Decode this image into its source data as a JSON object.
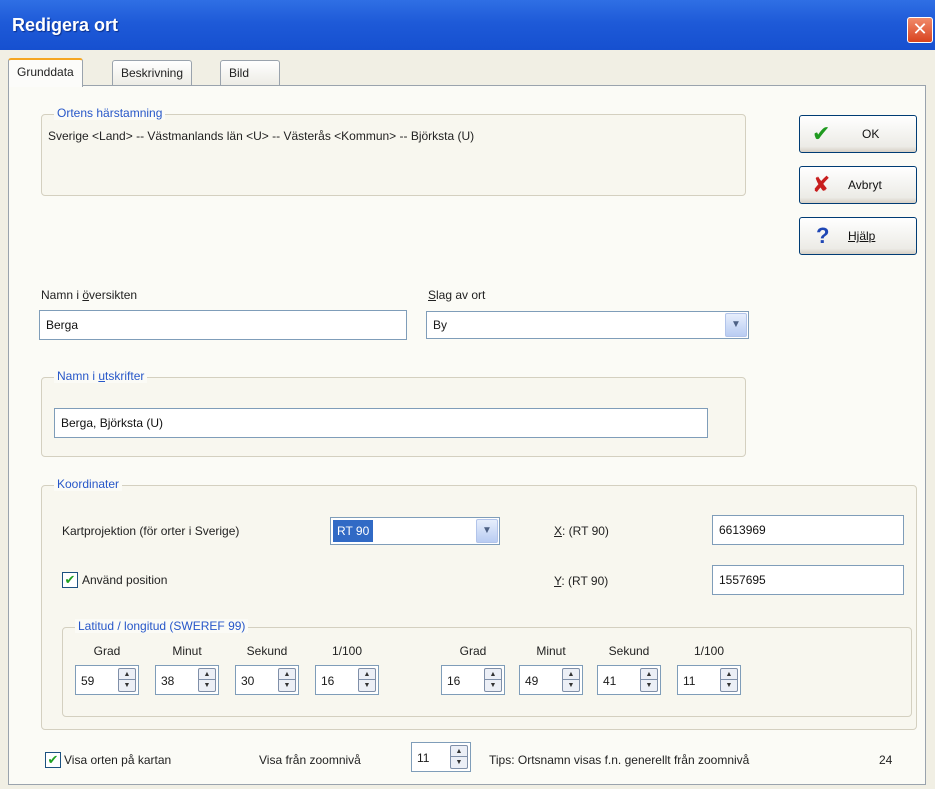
{
  "window": {
    "title": "Redigera ort",
    "close_glyph": "✕"
  },
  "tabs": [
    {
      "label": "Grunddata",
      "active": true
    },
    {
      "label": "Beskrivning",
      "active": false
    },
    {
      "label": "Bild",
      "active": false
    }
  ],
  "origin": {
    "legend": "Ortens härstamning",
    "text": "Sverige <Land> -- Västmanlands län <U> -- Västerås <Kommun> -- Björksta (U)"
  },
  "buttons": {
    "ok": {
      "label": "OK",
      "icon": "checkmark-icon",
      "glyph": "✔",
      "color": "#1f9a1f"
    },
    "cancel": {
      "label": "Avbryt",
      "icon": "cross-icon",
      "glyph": "✘",
      "color": "#c81e1e"
    },
    "help": {
      "label": "Hjälp",
      "icon": "question-icon",
      "glyph": "?",
      "color": "#1f47b5"
    }
  },
  "overview_name": {
    "label_pre": "Namn i ",
    "label_key": "ö",
    "label_post": "versikten",
    "value": "Berga"
  },
  "place_type": {
    "label_key": "S",
    "label_post": "lag av ort",
    "value": "By"
  },
  "print_name": {
    "legend_pre": "Namn i ",
    "legend_key": "u",
    "legend_post": "tskrifter",
    "value": "Berga, Björksta (U)"
  },
  "coordinates": {
    "legend": "Koordinater",
    "projection_label": "Kartprojektion (för orter i Sverige)",
    "projection_value": "RT 90",
    "x_key": "X",
    "x_label": ":  (RT 90)",
    "x_value": "6613969",
    "y_key": "Y",
    "y_label": ":  (RT 90)",
    "y_value": "1557695",
    "use_position_label": "Använd position",
    "use_position_checked": true,
    "latlon": {
      "legend": "Latitud / longitud (SWEREF 99)",
      "headers": [
        "Grad",
        "Minut",
        "Sekund",
        "1/100"
      ],
      "latitude": [
        "59",
        "38",
        "30",
        "16"
      ],
      "longitude": [
        "16",
        "49",
        "41",
        "11"
      ]
    }
  },
  "footer": {
    "show_on_map_label": "Visa orten på kartan",
    "show_on_map_checked": true,
    "zoom_label": "Visa från zoomnivå",
    "zoom_value": "11",
    "tip_text": "Tips: Ortsnamn visas f.n. generellt från  zoomnivå",
    "tip_zoom": "24"
  },
  "colors": {
    "titlebar": "#1e5ad8",
    "legend_text": "#2757c9",
    "selection": "#316ac5"
  }
}
